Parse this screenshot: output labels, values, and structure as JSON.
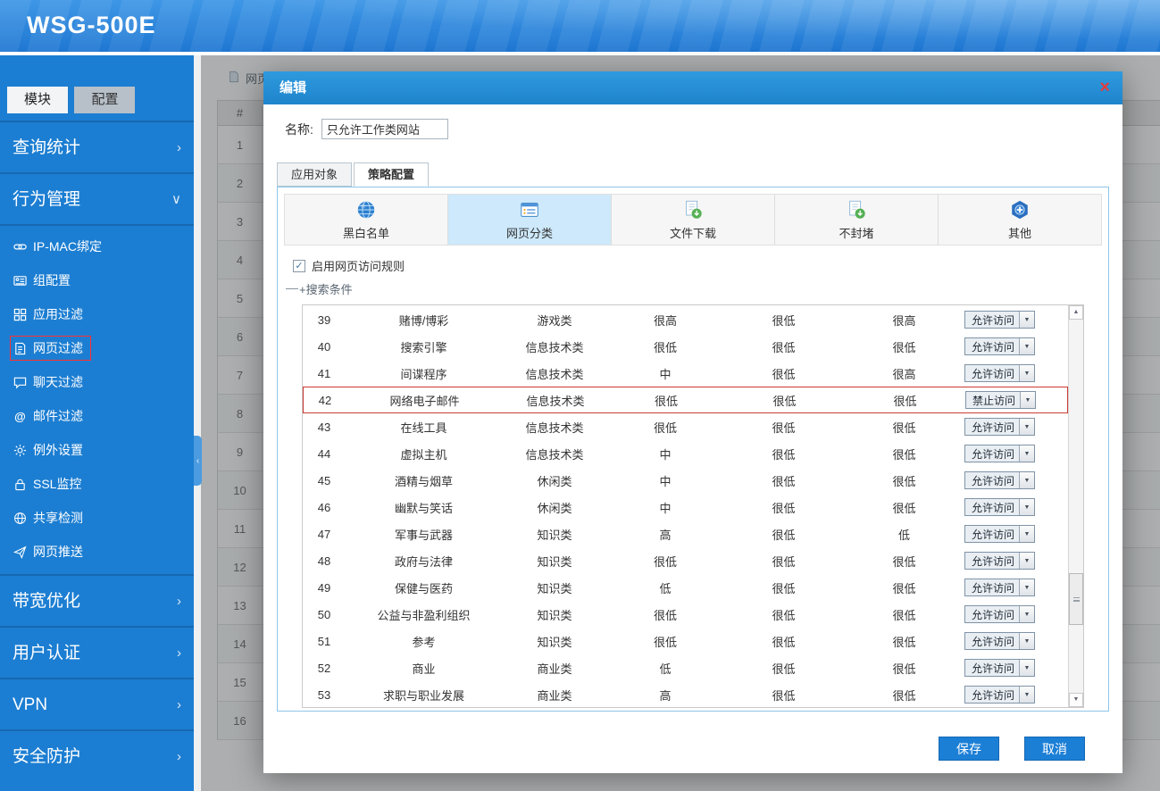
{
  "app": {
    "title": "WSG-500E"
  },
  "icons": {
    "check": "✓",
    "dropdown_arrow": "▼",
    "scroll_up": "▲",
    "scroll_down": "▼",
    "collapse_arrow": "‹",
    "close": "×"
  },
  "sidebar": {
    "tabs": [
      {
        "label": "模块"
      },
      {
        "label": "配置"
      }
    ],
    "sections": [
      {
        "label": "查询统计",
        "arrow": "›"
      },
      {
        "label": "行为管理",
        "arrow": "∨"
      },
      {
        "label": "带宽优化",
        "arrow": "›"
      },
      {
        "label": "用户认证",
        "arrow": "›"
      },
      {
        "label": "VPN",
        "arrow": "›"
      },
      {
        "label": "安全防护",
        "arrow": "›"
      }
    ],
    "submenu": [
      {
        "label": "IP-MAC绑定",
        "icon": "link-icon"
      },
      {
        "label": "组配置",
        "icon": "id-card-icon"
      },
      {
        "label": "应用过滤",
        "icon": "grid-icon"
      },
      {
        "label": "网页过滤",
        "icon": "web-page-icon",
        "selected": true
      },
      {
        "label": "聊天过滤",
        "icon": "chat-icon"
      },
      {
        "label": "邮件过滤",
        "icon": "at-icon"
      },
      {
        "label": "例外设置",
        "icon": "gear-icon"
      },
      {
        "label": "SSL监控",
        "icon": "lock-icon"
      },
      {
        "label": "共享检测",
        "icon": "globe-icon"
      },
      {
        "label": "网页推送",
        "icon": "send-icon"
      }
    ]
  },
  "background": {
    "breadcrumb": "网页",
    "table": {
      "header": "#",
      "row_numbers": [
        "1",
        "2",
        "3",
        "4",
        "5",
        "6",
        "7",
        "8",
        "9",
        "10",
        "11",
        "12",
        "13",
        "14",
        "15",
        "16"
      ]
    }
  },
  "modal": {
    "title": "编辑",
    "name_label": "名称:",
    "name_value": "只允许工作类网站",
    "tabs": [
      {
        "label": "应用对象",
        "active": false
      },
      {
        "label": "策略配置",
        "active": true
      }
    ],
    "category_tabs": [
      {
        "label": "黑白名单",
        "icon": "globe-icon",
        "active": false
      },
      {
        "label": "网页分类",
        "icon": "web-category-icon",
        "active": true
      },
      {
        "label": "文件下载",
        "icon": "file-download-icon",
        "active": false
      },
      {
        "label": "不封堵",
        "icon": "file-pass-icon",
        "active": false
      },
      {
        "label": "其他",
        "icon": "plus-hex-icon",
        "active": false
      }
    ],
    "enable_rule_label": "启用网页访问规则",
    "enable_rule_checked": true,
    "search_label": "+搜索条件",
    "table": {
      "rows": [
        {
          "no": "39",
          "name": "赌博/博彩",
          "category": "游戏类",
          "l1": "很高",
          "l2": "很低",
          "l3": "很高",
          "action": "允许访问",
          "highlight": false
        },
        {
          "no": "40",
          "name": "搜索引擎",
          "category": "信息技术类",
          "l1": "很低",
          "l2": "很低",
          "l3": "很低",
          "action": "允许访问",
          "highlight": false
        },
        {
          "no": "41",
          "name": "间谍程序",
          "category": "信息技术类",
          "l1": "中",
          "l2": "很低",
          "l3": "很高",
          "action": "允许访问",
          "highlight": false
        },
        {
          "no": "42",
          "name": "网络电子邮件",
          "category": "信息技术类",
          "l1": "很低",
          "l2": "很低",
          "l3": "很低",
          "action": "禁止访问",
          "highlight": true
        },
        {
          "no": "43",
          "name": "在线工具",
          "category": "信息技术类",
          "l1": "很低",
          "l2": "很低",
          "l3": "很低",
          "action": "允许访问",
          "highlight": false
        },
        {
          "no": "44",
          "name": "虚拟主机",
          "category": "信息技术类",
          "l1": "中",
          "l2": "很低",
          "l3": "很低",
          "action": "允许访问",
          "highlight": false
        },
        {
          "no": "45",
          "name": "酒精与烟草",
          "category": "休闲类",
          "l1": "中",
          "l2": "很低",
          "l3": "很低",
          "action": "允许访问",
          "highlight": false
        },
        {
          "no": "46",
          "name": "幽默与笑话",
          "category": "休闲类",
          "l1": "中",
          "l2": "很低",
          "l3": "很低",
          "action": "允许访问",
          "highlight": false
        },
        {
          "no": "47",
          "name": "军事与武器",
          "category": "知识类",
          "l1": "高",
          "l2": "很低",
          "l3": "低",
          "action": "允许访问",
          "highlight": false
        },
        {
          "no": "48",
          "name": "政府与法律",
          "category": "知识类",
          "l1": "很低",
          "l2": "很低",
          "l3": "很低",
          "action": "允许访问",
          "highlight": false
        },
        {
          "no": "49",
          "name": "保健与医药",
          "category": "知识类",
          "l1": "低",
          "l2": "很低",
          "l3": "很低",
          "action": "允许访问",
          "highlight": false
        },
        {
          "no": "50",
          "name": "公益与非盈利组织",
          "category": "知识类",
          "l1": "很低",
          "l2": "很低",
          "l3": "很低",
          "action": "允许访问",
          "highlight": false
        },
        {
          "no": "51",
          "name": "参考",
          "category": "知识类",
          "l1": "很低",
          "l2": "很低",
          "l3": "很低",
          "action": "允许访问",
          "highlight": false
        },
        {
          "no": "52",
          "name": "商业",
          "category": "商业类",
          "l1": "低",
          "l2": "很低",
          "l3": "很低",
          "action": "允许访问",
          "highlight": false
        },
        {
          "no": "53",
          "name": "求职与职业发展",
          "category": "商业类",
          "l1": "高",
          "l2": "很低",
          "l3": "很低",
          "action": "允许访问",
          "highlight": false
        }
      ]
    },
    "save_label": "保存",
    "cancel_label": "取消"
  }
}
